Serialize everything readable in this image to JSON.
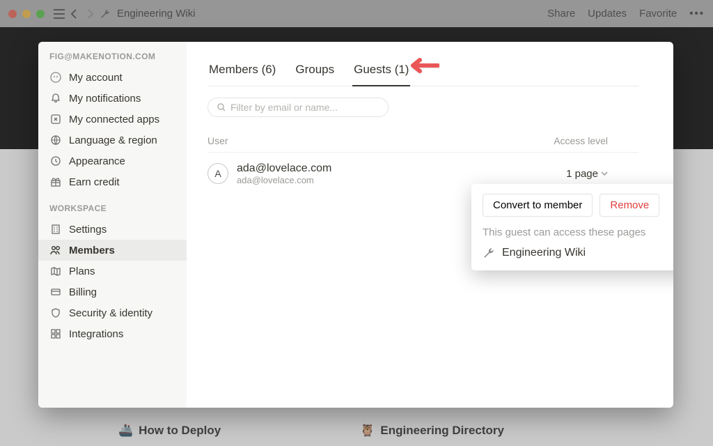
{
  "titlebar": {
    "title": "Engineering Wiki",
    "actions": [
      "Share",
      "Updates",
      "Favorite"
    ]
  },
  "background_links": {
    "left": "How to Deploy",
    "right": "Engineering Directory"
  },
  "sidebar": {
    "account_header": "FIG@MAKENOTION.COM",
    "workspace_header": "WORKSPACE",
    "account_items": [
      {
        "label": "My account"
      },
      {
        "label": "My notifications"
      },
      {
        "label": "My connected apps"
      },
      {
        "label": "Language & region"
      },
      {
        "label": "Appearance"
      },
      {
        "label": "Earn credit"
      }
    ],
    "workspace_items": [
      {
        "label": "Settings"
      },
      {
        "label": "Members"
      },
      {
        "label": "Plans"
      },
      {
        "label": "Billing"
      },
      {
        "label": "Security & identity"
      },
      {
        "label": "Integrations"
      }
    ]
  },
  "tabs": {
    "members": "Members (6)",
    "groups": "Groups",
    "guests": "Guests (1)"
  },
  "filter": {
    "placeholder": "Filter by email or name..."
  },
  "columns": {
    "user": "User",
    "access": "Access level"
  },
  "guest": {
    "initial": "A",
    "name": "ada@lovelace.com",
    "email": "ada@lovelace.com",
    "access": "1 page"
  },
  "popover": {
    "convert": "Convert to member",
    "remove": "Remove",
    "note": "This guest can access these pages",
    "page": "Engineering Wiki"
  }
}
